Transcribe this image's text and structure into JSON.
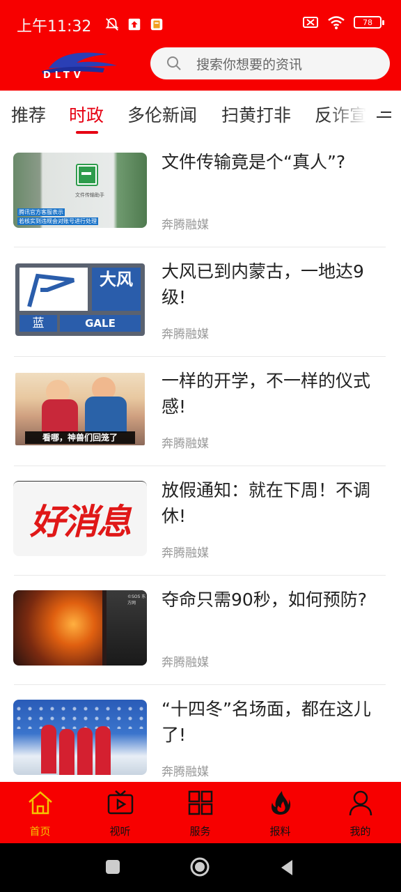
{
  "status_bar": {
    "time": "上午11:32",
    "battery": "78"
  },
  "header": {
    "logo_text": "DLTV",
    "search_placeholder": "搜索你想要的资讯"
  },
  "tabs": [
    {
      "label": "推荐",
      "active": false
    },
    {
      "label": "时政",
      "active": true
    },
    {
      "label": "多伦新闻",
      "active": false
    },
    {
      "label": "扫黄打非",
      "active": false
    },
    {
      "label": "反诈宣",
      "active": false
    }
  ],
  "articles": [
    {
      "title": "文件传输竟是个“真人”?",
      "source": "奔腾融媒",
      "thumb_caption_line1": "腾讯官方客服表示",
      "thumb_caption_line2": "若核实到违规会对账号进行处理",
      "thumb_card_text": "文件传输助手"
    },
    {
      "title": "大风已到内蒙古，一地达9级!",
      "source": "奔腾融媒",
      "thumb_big_char": "大风",
      "thumb_color_label": "蓝",
      "thumb_word": "GALE"
    },
    {
      "title": "一样的开学，不一样的仪式感!",
      "source": "奔腾融媒",
      "thumb_caption": "看哪，神兽们回笼了"
    },
    {
      "title": "放假通知：就在下周！不调休!",
      "source": "奔腾融媒",
      "thumb_big_text": "好消息"
    },
    {
      "title": "夺命只需90秒，如何预防?",
      "source": "奔腾融媒",
      "thumb_watermark": "©SOS 东方网"
    },
    {
      "title": "“十四冬”名场面，都在这儿了!",
      "source": "奔腾融媒"
    }
  ],
  "bottom_nav": [
    {
      "label": "首页",
      "icon": "home-icon",
      "active": true
    },
    {
      "label": "视听",
      "icon": "tv-icon",
      "active": false
    },
    {
      "label": "服务",
      "icon": "grid-icon",
      "active": false
    },
    {
      "label": "报料",
      "icon": "fire-icon",
      "active": false
    },
    {
      "label": "我的",
      "icon": "user-icon",
      "active": false
    }
  ],
  "colors": {
    "brand_red": "#f70000",
    "tab_active": "#e60012",
    "nav_active": "#f5c400"
  }
}
